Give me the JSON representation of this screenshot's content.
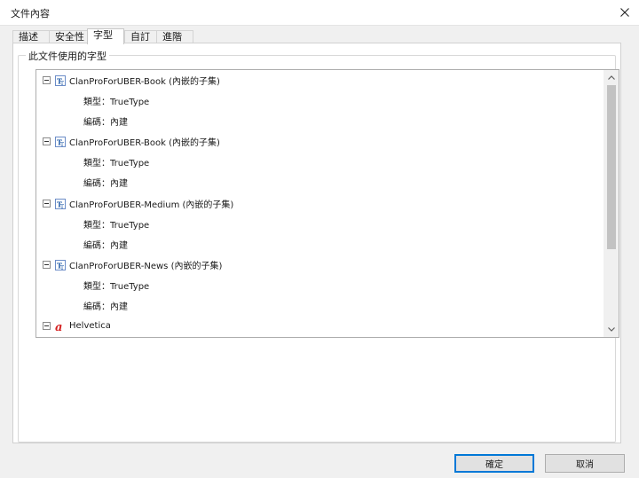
{
  "window": {
    "title": "文件內容"
  },
  "tabs": [
    {
      "label": "描述"
    },
    {
      "label": "安全性"
    },
    {
      "label": "字型"
    },
    {
      "label": "自訂"
    },
    {
      "label": "進階"
    }
  ],
  "fonts_group": {
    "label": "此文件使用的字型"
  },
  "fonts": [
    {
      "name": "ClanProForUBER-Book (內嵌的子集)",
      "type": "類型：TrueType",
      "encoding": "編碼：內建",
      "icon": "truetype-font-icon"
    },
    {
      "name": "ClanProForUBER-Book (內嵌的子集)",
      "type": "類型：TrueType",
      "encoding": "編碼：內建",
      "icon": "truetype-font-icon"
    },
    {
      "name": "ClanProForUBER-Medium (內嵌的子集)",
      "type": "類型：TrueType",
      "encoding": "編碼：內建",
      "icon": "truetype-font-icon"
    },
    {
      "name": "ClanProForUBER-News (內嵌的子集)",
      "type": "類型：TrueType",
      "encoding": "編碼：內建",
      "icon": "truetype-font-icon"
    },
    {
      "name": "Helvetica",
      "icon": "type1-font-icon"
    }
  ],
  "buttons": {
    "ok": "確定",
    "cancel": "取消"
  },
  "colors": {
    "accent": "#0078d7",
    "type1_icon": "#d42020",
    "truetype_icon": "#1f5aa6"
  }
}
